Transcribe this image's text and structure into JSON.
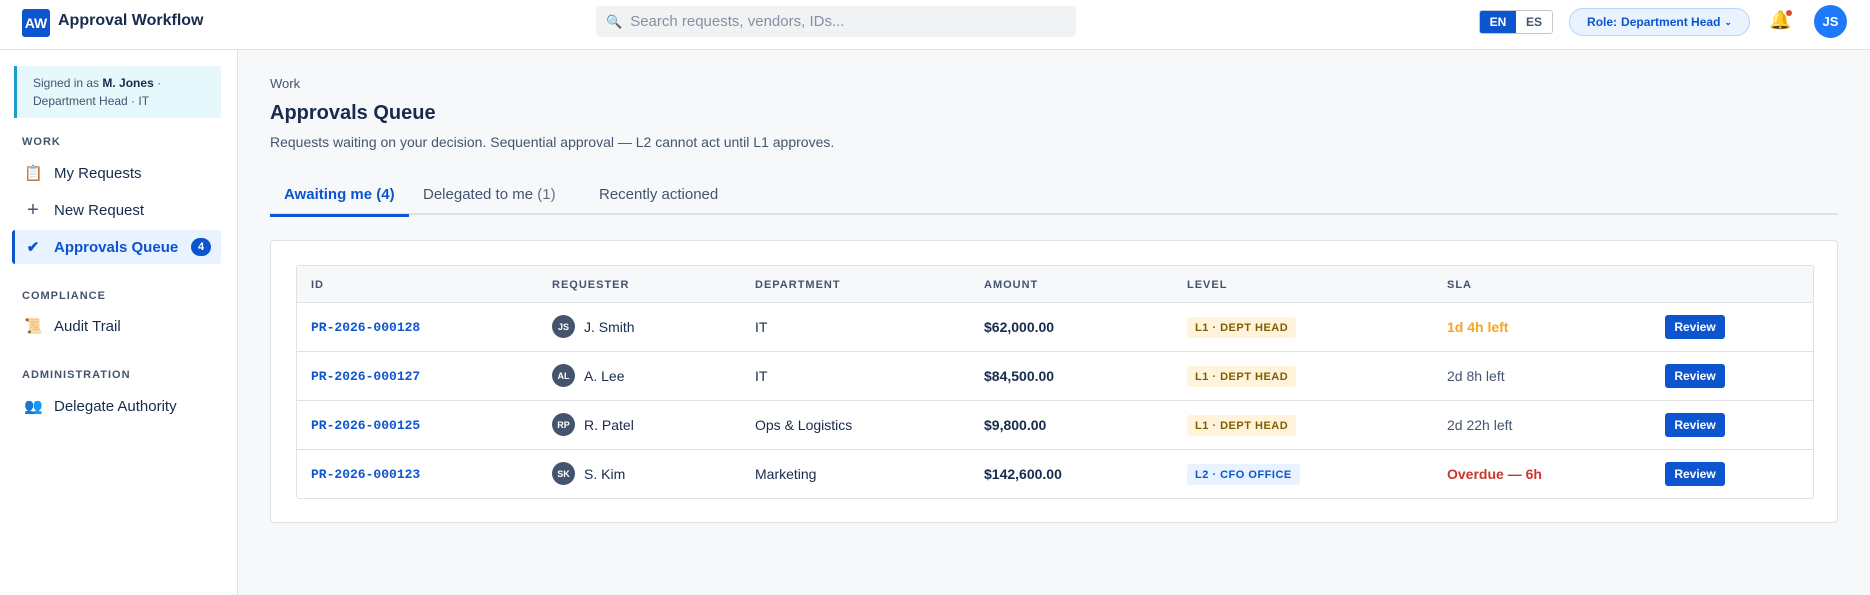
{
  "header": {
    "logo": "AW",
    "title": "Approval Workflow",
    "search_placeholder": "Search requests, vendors, IDs...",
    "languages": [
      {
        "label": "EN",
        "active": true
      },
      {
        "label": "ES",
        "active": false
      }
    ],
    "role_label": "Role:",
    "role_value": "Department Head",
    "user_initials": "JS"
  },
  "sidebar": {
    "signed_prefix": "Signed in as",
    "signed_name": "M. Jones",
    "signed_suffix": " ·",
    "signed_detail": "Department Head · IT",
    "sections": [
      {
        "label": "WORK",
        "items": [
          {
            "label": "My Requests",
            "icon": "clipboard-icon"
          },
          {
            "label": "New Request",
            "icon": "plus-icon"
          },
          {
            "label": "Approvals Queue",
            "icon": "check-icon",
            "active": true,
            "badge": "4"
          }
        ]
      },
      {
        "label": "COMPLIANCE",
        "items": [
          {
            "label": "Audit Trail",
            "icon": "scroll-icon"
          }
        ]
      },
      {
        "label": "ADMINISTRATION",
        "items": [
          {
            "label": "Delegate Authority",
            "icon": "users-icon"
          }
        ]
      }
    ]
  },
  "main": {
    "breadcrumb": "Work",
    "title": "Approvals Queue",
    "description": "Requests waiting on your decision. Sequential approval — L2 cannot act until L1 approves.",
    "tabs": [
      {
        "label": "Awaiting me",
        "count": "(4)",
        "active": true
      },
      {
        "label": "Delegated to me",
        "count": "(1)"
      },
      {
        "label": "Recently actioned",
        "count": ""
      }
    ],
    "columns": [
      "ID",
      "REQUESTER",
      "DEPARTMENT",
      "AMOUNT",
      "LEVEL",
      "SLA"
    ],
    "rows": [
      {
        "id": "PR-2026-000128",
        "initials": "JS",
        "requester": "J. Smith",
        "department": "IT",
        "amount": "$62,000.00",
        "level": "L1 · DEPT HEAD",
        "level_kind": "l1",
        "sla": "1d 4h left",
        "sla_kind": "warn",
        "action": "Review"
      },
      {
        "id": "PR-2026-000127",
        "initials": "AL",
        "requester": "A. Lee",
        "department": "IT",
        "amount": "$84,500.00",
        "level": "L1 · DEPT HEAD",
        "level_kind": "l1",
        "sla": "2d 8h left",
        "sla_kind": "norm",
        "action": "Review"
      },
      {
        "id": "PR-2026-000125",
        "initials": "RP",
        "requester": "R. Patel",
        "department": "Ops & Logistics",
        "amount": "$9,800.00",
        "level": "L1 · DEPT HEAD",
        "level_kind": "l1",
        "sla": "2d 22h left",
        "sla_kind": "norm",
        "action": "Review"
      },
      {
        "id": "PR-2026-000123",
        "initials": "SK",
        "requester": "S. Kim",
        "department": "Marketing",
        "amount": "$142,600.00",
        "level": "L2 · CFO OFFICE",
        "level_kind": "l2",
        "sla": "Overdue — 6h",
        "sla_kind": "over",
        "action": "Review"
      }
    ]
  },
  "colors": {
    "accent": "#0c55cf",
    "warn": "#f5a623",
    "overdue": "#c9372c"
  }
}
